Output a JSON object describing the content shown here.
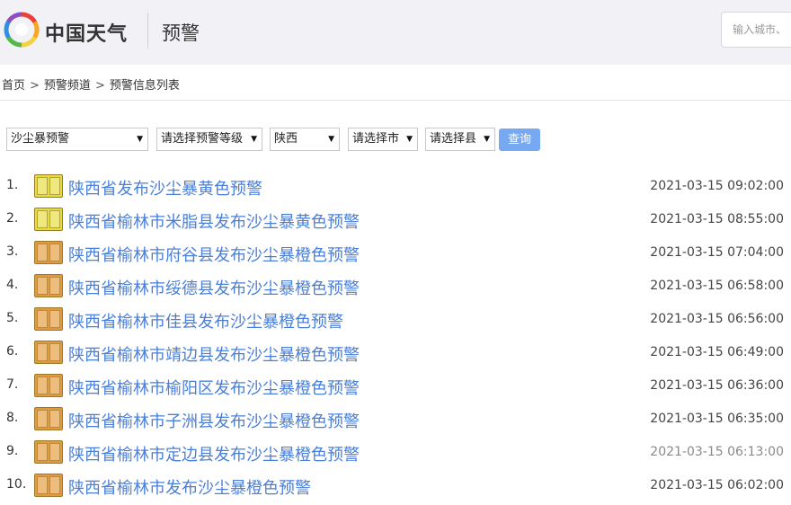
{
  "header": {
    "site_name": "中国天气",
    "section_title": "预警",
    "search_placeholder": "输入城市、"
  },
  "breadcrumb": {
    "items": [
      "首页",
      "预警频道",
      "预警信息列表"
    ],
    "separator": ">"
  },
  "filters": {
    "warning_type": "沙尘暴预警",
    "warning_level": "请选择预警等级",
    "province": "陕西",
    "city": "请选择市",
    "county": "请选择县",
    "query_label": "查询"
  },
  "warnings": [
    {
      "index": "1.",
      "level": "yellow",
      "title": "陕西省发布沙尘暴黄色预警",
      "time": "2021-03-15 09:02:00"
    },
    {
      "index": "2.",
      "level": "yellow",
      "title": "陕西省榆林市米脂县发布沙尘暴黄色预警",
      "time": "2021-03-15 08:55:00"
    },
    {
      "index": "3.",
      "level": "orange",
      "title": "陕西省榆林市府谷县发布沙尘暴橙色预警",
      "time": "2021-03-15 07:04:00"
    },
    {
      "index": "4.",
      "level": "orange",
      "title": "陕西省榆林市绥德县发布沙尘暴橙色预警",
      "time": "2021-03-15 06:58:00"
    },
    {
      "index": "5.",
      "level": "orange",
      "title": "陕西省榆林市佳县发布沙尘暴橙色预警",
      "time": "2021-03-15 06:56:00"
    },
    {
      "index": "6.",
      "level": "orange",
      "title": "陕西省榆林市靖边县发布沙尘暴橙色预警",
      "time": "2021-03-15 06:49:00"
    },
    {
      "index": "7.",
      "level": "orange",
      "title": "陕西省榆林市榆阳区发布沙尘暴橙色预警",
      "time": "2021-03-15 06:36:00"
    },
    {
      "index": "8.",
      "level": "orange",
      "title": "陕西省榆林市子洲县发布沙尘暴橙色预警",
      "time": "2021-03-15 06:35:00"
    },
    {
      "index": "9.",
      "level": "orange",
      "title": "陕西省榆林市定边县发布沙尘暴橙色预警",
      "time": "2021-03-15 06:13:00"
    },
    {
      "index": "10.",
      "level": "orange",
      "title": "陕西省榆林市发布沙尘暴橙色预警",
      "time": "2021-03-15 06:02:00"
    }
  ],
  "colors": {
    "link": "#4a7fd9",
    "query_button": "#76a9f2",
    "header_bg": "#f1f1f6",
    "yellow_badge": "#e6dc3a",
    "orange_badge": "#e49a3a"
  }
}
